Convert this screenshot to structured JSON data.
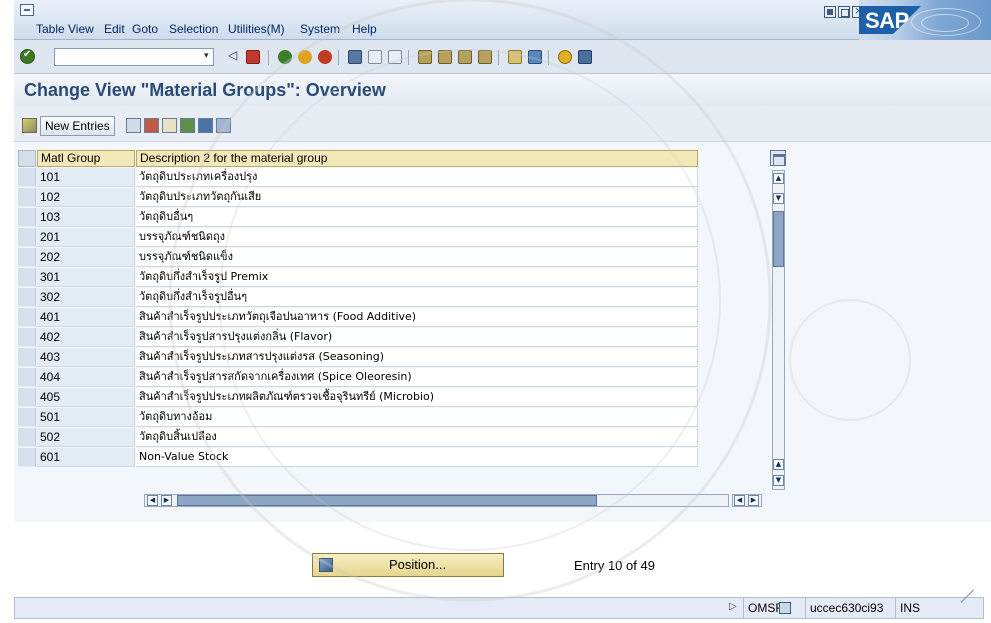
{
  "menubar": {
    "items": [
      {
        "label": "Table View"
      },
      {
        "label": "Edit"
      },
      {
        "label": "Goto"
      },
      {
        "label": "Selection"
      },
      {
        "label": "Utilities(M)"
      },
      {
        "label": "System"
      },
      {
        "label": "Help"
      }
    ]
  },
  "logo": {
    "text": "SAP"
  },
  "page": {
    "title": "Change View \"Material Groups\": Overview"
  },
  "app_toolbar": {
    "new_entries_label": "New Entries"
  },
  "table": {
    "headers": {
      "group": "Matl Group",
      "description": "Description 2 for the material group"
    },
    "rows": [
      {
        "group": "101",
        "description": "วัตถุดิบประเภทเครื่องปรุง"
      },
      {
        "group": "102",
        "description": "วัตถุดิบประเภทวัตถุกันเสีย"
      },
      {
        "group": "103",
        "description": "วัตถุดิบอื่นๆ"
      },
      {
        "group": "201",
        "description": "บรรจุภัณฑ์ชนิดถุง"
      },
      {
        "group": "202",
        "description": "บรรจุภัณฑ์ชนิดแข็ง"
      },
      {
        "group": "301",
        "description": "วัตถุดิบกึ่งสำเร็จรูป Premix"
      },
      {
        "group": "302",
        "description": "วัตถุดิบกึ่งสำเร็จรูปอื่นๆ"
      },
      {
        "group": "401",
        "description": "สินค้าสำเร็จรูปประเภทวัตถุเจือปนอาหาร (Food Additive)"
      },
      {
        "group": "402",
        "description": "สินค้าสำเร็จรูปสารปรุงแต่งกลิ่น (Flavor)"
      },
      {
        "group": "403",
        "description": "สินค้าสำเร็จรูปประเภทสารปรุงแต่งรส (Seasoning)"
      },
      {
        "group": "404",
        "description": "สินค้าสำเร็จรูปสารสกัดจากเครื่องเทศ (Spice Oleoresin)"
      },
      {
        "group": "405",
        "description": "สินค้าสำเร็จรูปประเภทผลิตภัณฑ์ตรวจเชื้อจุรินทรีย์ (Microbio)"
      },
      {
        "group": "501",
        "description": "วัตถุดิบทางอ้อม"
      },
      {
        "group": "502",
        "description": "วัตถุดิบสิ้นเปลือง"
      },
      {
        "group": "601",
        "description": "Non-Value Stock"
      }
    ]
  },
  "position": {
    "button_label": "Position...",
    "entry_info": "Entry 10 of 49"
  },
  "statusbar": {
    "system": "OMSF",
    "client": "uccec630ci93",
    "mode": "INS"
  },
  "colors": {
    "title": "#2a4a78",
    "header_bg": "#f2e8b8",
    "menu_text": "#002566",
    "sap_blue": "#1e5faa"
  }
}
